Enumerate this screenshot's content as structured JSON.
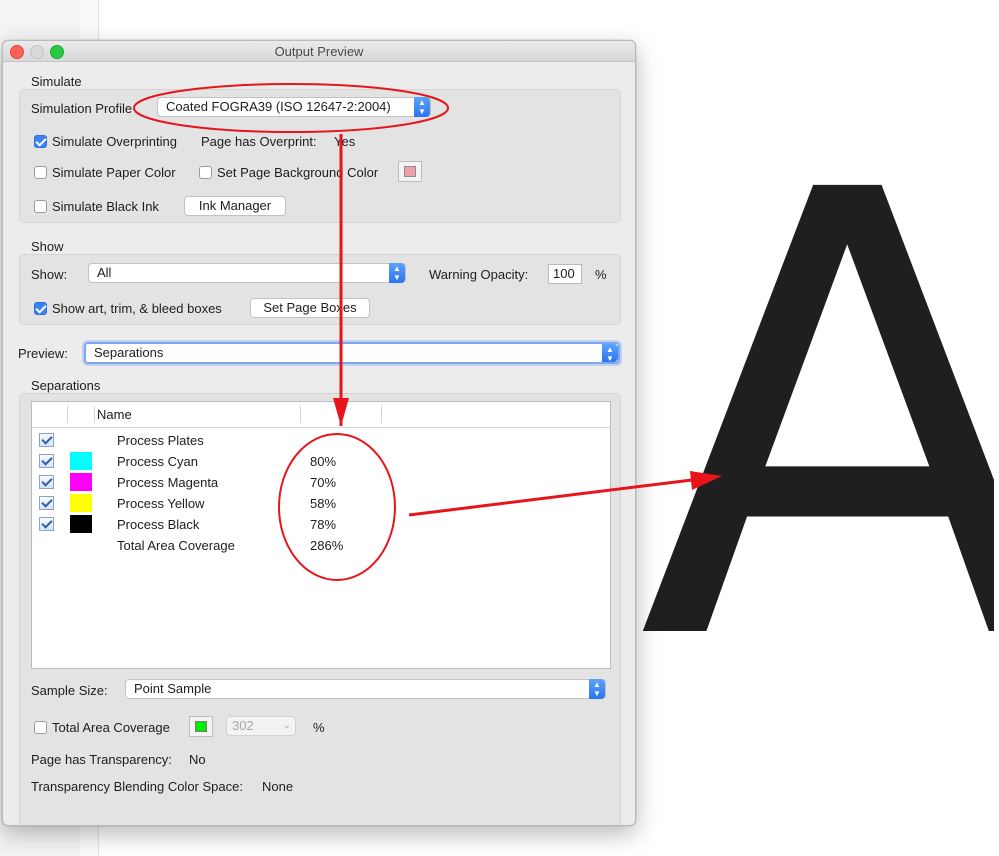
{
  "window": {
    "title": "Output Preview"
  },
  "simulate": {
    "section_label": "Simulate",
    "profile_label": "Simulation Profile",
    "profile_value": "Coated FOGRA39 (ISO 12647-2:2004)",
    "overprinting_label": "Simulate Overprinting",
    "overprinting_checked": true,
    "page_overprint_label": "Page has Overprint:",
    "page_overprint_value": "Yes",
    "paper_color_label": "Simulate Paper Color",
    "page_background_label": "Set Page Background Color",
    "page_background_color": "#f0a0a6",
    "black_ink_label": "Simulate Black Ink",
    "ink_manager_label": "Ink Manager"
  },
  "show": {
    "section_label": "Show",
    "show_label": "Show:",
    "show_value": "All",
    "warning_opacity_label": "Warning Opacity:",
    "warning_opacity_value": "100",
    "warning_opacity_unit": "%",
    "art_boxes_label": "Show art, trim, & bleed boxes",
    "art_boxes_checked": true,
    "set_page_boxes_label": "Set Page Boxes"
  },
  "preview": {
    "label": "Preview:",
    "value": "Separations"
  },
  "separations": {
    "section_label": "Separations",
    "name_header": "Name",
    "rows": [
      {
        "name": "Process Plates",
        "value": "",
        "checked": true,
        "color": ""
      },
      {
        "name": "Process Cyan",
        "value": "80%",
        "checked": true,
        "color": "#00ffff"
      },
      {
        "name": "Process Magenta",
        "value": "70%",
        "checked": true,
        "color": "#ff00ff"
      },
      {
        "name": "Process Yellow",
        "value": "58%",
        "checked": true,
        "color": "#ffff00"
      },
      {
        "name": "Process Black",
        "value": "78%",
        "checked": true,
        "color": "#000000"
      },
      {
        "name": "Total Area Coverage",
        "value": "286%",
        "checked": false,
        "color": ""
      }
    ]
  },
  "sample": {
    "label": "Sample Size:",
    "value": "Point Sample"
  },
  "coverage": {
    "label": "Total Area Coverage",
    "swatch_color": "#00ee00",
    "value": "302",
    "unit": "%"
  },
  "transparency": {
    "label": "Page has Transparency:",
    "value": "No",
    "blend_label": "Transparency Blending Color Space:",
    "blend_value": "None"
  },
  "background": {
    "letter": "A"
  },
  "annotation_color": "#e8141b"
}
